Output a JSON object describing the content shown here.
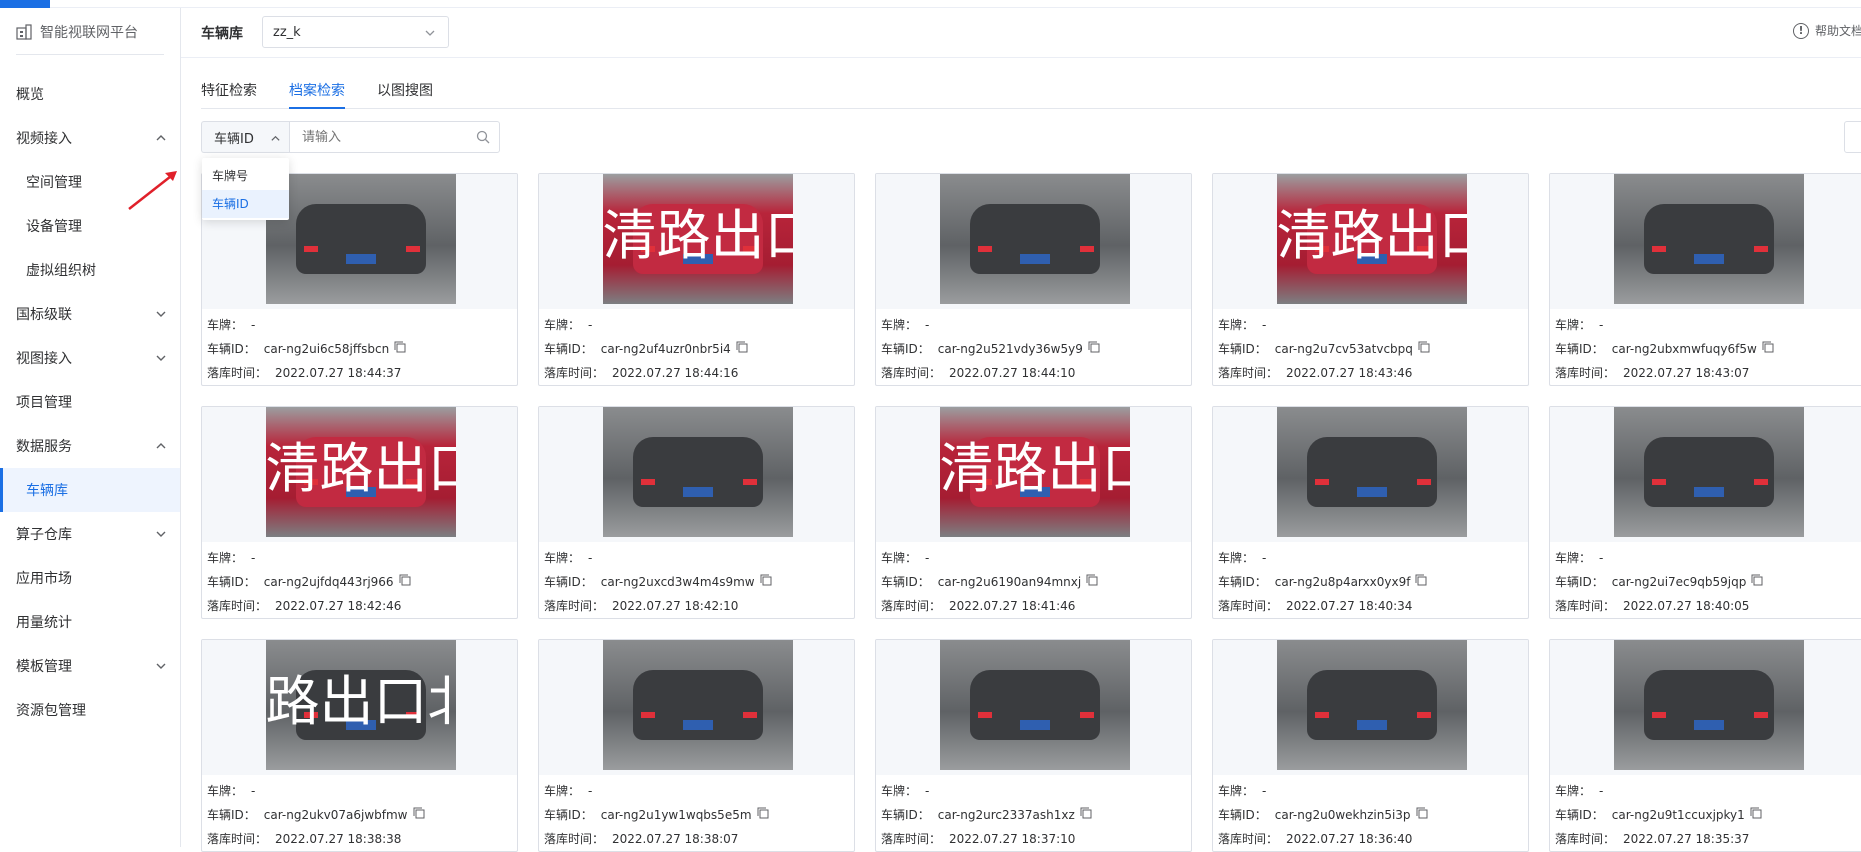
{
  "sidebar": {
    "logo_text": "智能视联网平台",
    "items": [
      {
        "label": "概览",
        "chevron": "none",
        "level": 0,
        "active": false
      },
      {
        "label": "视频接入",
        "chevron": "up",
        "level": 0,
        "active": false
      },
      {
        "label": "空间管理",
        "chevron": "none",
        "level": 1,
        "active": false
      },
      {
        "label": "设备管理",
        "chevron": "none",
        "level": 1,
        "active": false
      },
      {
        "label": "虚拟组织树",
        "chevron": "none",
        "level": 1,
        "active": false
      },
      {
        "label": "国标级联",
        "chevron": "down",
        "level": 0,
        "active": false
      },
      {
        "label": "视图接入",
        "chevron": "down",
        "level": 0,
        "active": false
      },
      {
        "label": "项目管理",
        "chevron": "none",
        "level": 0,
        "active": false
      },
      {
        "label": "数据服务",
        "chevron": "up",
        "level": 0,
        "active": false
      },
      {
        "label": "车辆库",
        "chevron": "none",
        "level": 1,
        "active": true
      },
      {
        "label": "算子仓库",
        "chevron": "down",
        "level": 0,
        "active": false
      },
      {
        "label": "应用市场",
        "chevron": "none",
        "level": 0,
        "active": false
      },
      {
        "label": "用量统计",
        "chevron": "none",
        "level": 0,
        "active": false
      },
      {
        "label": "模板管理",
        "chevron": "down",
        "level": 0,
        "active": false
      },
      {
        "label": "资源包管理",
        "chevron": "none",
        "level": 0,
        "active": false
      }
    ]
  },
  "header": {
    "label": "车辆库",
    "library_select": "zz_k",
    "help_text": "帮助文档"
  },
  "tabs": [
    {
      "label": "特征检索",
      "active": false
    },
    {
      "label": "档案检索",
      "active": true
    },
    {
      "label": "以图搜图",
      "active": false
    }
  ],
  "search": {
    "type_selected": "车辆ID",
    "placeholder": "请输入"
  },
  "dropdown": {
    "options": [
      {
        "label": "车牌号",
        "selected": false
      },
      {
        "label": "车辆ID",
        "selected": true
      }
    ]
  },
  "field_labels": {
    "plate": "车牌：",
    "vehicle_id": "车辆ID：",
    "time": "落库时间："
  },
  "cards": [
    {
      "plate": "-",
      "vehicle_id": "car-ng2ui6c58jffsbcn",
      "time": "2022.07.27 18:44:37",
      "color": "gray",
      "overlay": ""
    },
    {
      "plate": "-",
      "vehicle_id": "car-ng2uf4uzr0nbr5i4",
      "time": "2022.07.27 18:44:16",
      "color": "red",
      "overlay": "清路出口"
    },
    {
      "plate": "-",
      "vehicle_id": "car-ng2u521vdy36w5y9",
      "time": "2022.07.27 18:44:10",
      "color": "gray",
      "overlay": ""
    },
    {
      "plate": "-",
      "vehicle_id": "car-ng2u7cv53atvcbpq",
      "time": "2022.07.27 18:43:46",
      "color": "red",
      "overlay": "清路出口"
    },
    {
      "plate": "-",
      "vehicle_id": "car-ng2ubxmwfuqy6f5w",
      "time": "2022.07.27 18:43:07",
      "color": "gray",
      "overlay": ""
    },
    {
      "plate": "-",
      "vehicle_id": "car-ng2ujfdq443rj966",
      "time": "2022.07.27 18:42:46",
      "color": "red",
      "overlay": "清路出口"
    },
    {
      "plate": "-",
      "vehicle_id": "car-ng2uxcd3w4m4s9mw",
      "time": "2022.07.27 18:42:10",
      "color": "gray",
      "overlay": ""
    },
    {
      "plate": "-",
      "vehicle_id": "car-ng2u6190an94mnxj",
      "time": "2022.07.27 18:41:46",
      "color": "red",
      "overlay": "清路出口"
    },
    {
      "plate": "-",
      "vehicle_id": "car-ng2u8p4arxx0yx9f",
      "time": "2022.07.27 18:40:34",
      "color": "gray",
      "overlay": ""
    },
    {
      "plate": "-",
      "vehicle_id": "car-ng2ui7ec9qb59jqp",
      "time": "2022.07.27 18:40:05",
      "color": "gray",
      "overlay": ""
    },
    {
      "plate": "-",
      "vehicle_id": "car-ng2ukv07a6jwbfmw",
      "time": "2022.07.27 18:38:38",
      "color": "gray",
      "overlay": "路出口北"
    },
    {
      "plate": "-",
      "vehicle_id": "car-ng2u1yw1wqbs5e5m",
      "time": "2022.07.27 18:38:07",
      "color": "gray",
      "overlay": ""
    },
    {
      "plate": "-",
      "vehicle_id": "car-ng2urc2337ash1xz",
      "time": "2022.07.27 18:37:10",
      "color": "gray",
      "overlay": ""
    },
    {
      "plate": "-",
      "vehicle_id": "car-ng2u0wekhzin5i3p",
      "time": "2022.07.27 18:36:40",
      "color": "gray",
      "overlay": ""
    },
    {
      "plate": "-",
      "vehicle_id": "car-ng2u9t1ccuxjpky1",
      "time": "2022.07.27 18:35:37",
      "color": "gray",
      "overlay": ""
    }
  ],
  "colors": {
    "accent": "#1b6fe4",
    "sidebar_active_bg": "#eef4fe",
    "border": "#dcdfe6",
    "annotation_arrow": "#e0202a"
  }
}
